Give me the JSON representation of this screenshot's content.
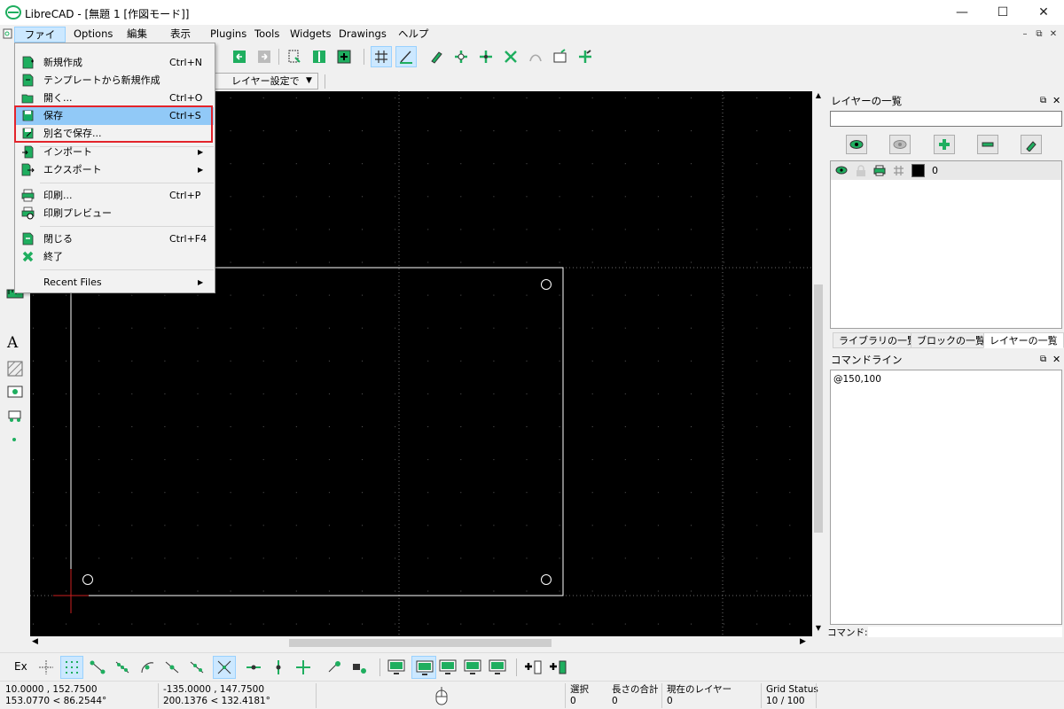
{
  "window": {
    "title": "LibreCAD - [無題 1 [作図モード]]",
    "controls": {
      "minimize": "—",
      "maximize": "☐",
      "close": "✕"
    }
  },
  "menubar": {
    "items": [
      "ファイル",
      "Options",
      "編集",
      "表示",
      "Plugins",
      "Tools",
      "Widgets",
      "Drawings",
      "ヘルプ"
    ],
    "mdi_controls": [
      "–",
      "⧉",
      "✕"
    ]
  },
  "file_menu": {
    "items": [
      {
        "label": "新規作成",
        "shortcut": "Ctrl+N",
        "icon": "new-file-icon"
      },
      {
        "label": "テンプレートから新規作成",
        "shortcut": "",
        "icon": "new-from-template-icon"
      },
      {
        "label": "開く...",
        "shortcut": "Ctrl+O",
        "icon": "open-folder-icon"
      },
      {
        "label": "保存",
        "shortcut": "Ctrl+S",
        "icon": "save-icon",
        "highlighted": true
      },
      {
        "label": "別名で保存...",
        "shortcut": "",
        "icon": "save-as-icon"
      },
      {
        "label": "インポート",
        "submenu": true,
        "icon": "import-icon"
      },
      {
        "label": "エクスポート",
        "submenu": true,
        "icon": "export-icon"
      },
      {
        "label": "印刷...",
        "shortcut": "Ctrl+P",
        "icon": "print-icon"
      },
      {
        "label": "印刷プレビュー",
        "shortcut": "",
        "icon": "print-preview-icon"
      },
      {
        "label": "閉じる",
        "shortcut": "Ctrl+F4",
        "icon": "close-file-icon"
      },
      {
        "label": "終了",
        "shortcut": "",
        "icon": "exit-icon"
      },
      {
        "label": "Recent Files",
        "submenu": true,
        "icon": ""
      }
    ],
    "submenu_arrow": "▶"
  },
  "toolbar2": {
    "layer_combo": "レイヤー設定で"
  },
  "layer_panel": {
    "title": "レイヤーの一覧",
    "filter_value": "",
    "layers": [
      {
        "name": "0",
        "color": "#000000"
      }
    ],
    "tabs": [
      "ライブラリの一覧",
      "ブロックの一覧",
      "レイヤーの一覧"
    ]
  },
  "command_panel": {
    "title": "コマンドライン",
    "history": "@150,100",
    "prompt_label": "コマンド:"
  },
  "snapbar": {
    "label": "Ex"
  },
  "status": {
    "coord_abs": "10.0000 , 152.7500",
    "coord_abs_polar": "153.0770 < 86.2544°",
    "coord_rel": "-135.0000 , 147.7500",
    "coord_rel_polar": "200.1376 < 132.4181°",
    "selected_label": "選択",
    "selected_value": "0",
    "length_label": "長さの合計",
    "length_value": "0",
    "current_layer_label": "現在のレイヤー",
    "current_layer_value": "0",
    "grid_label": "Grid Status",
    "grid_value": "10 / 100"
  },
  "colors": {
    "accent": "#1fae5f",
    "canvas": "#000000",
    "highlight": "#e3242b",
    "selection": "#91c9f7"
  }
}
